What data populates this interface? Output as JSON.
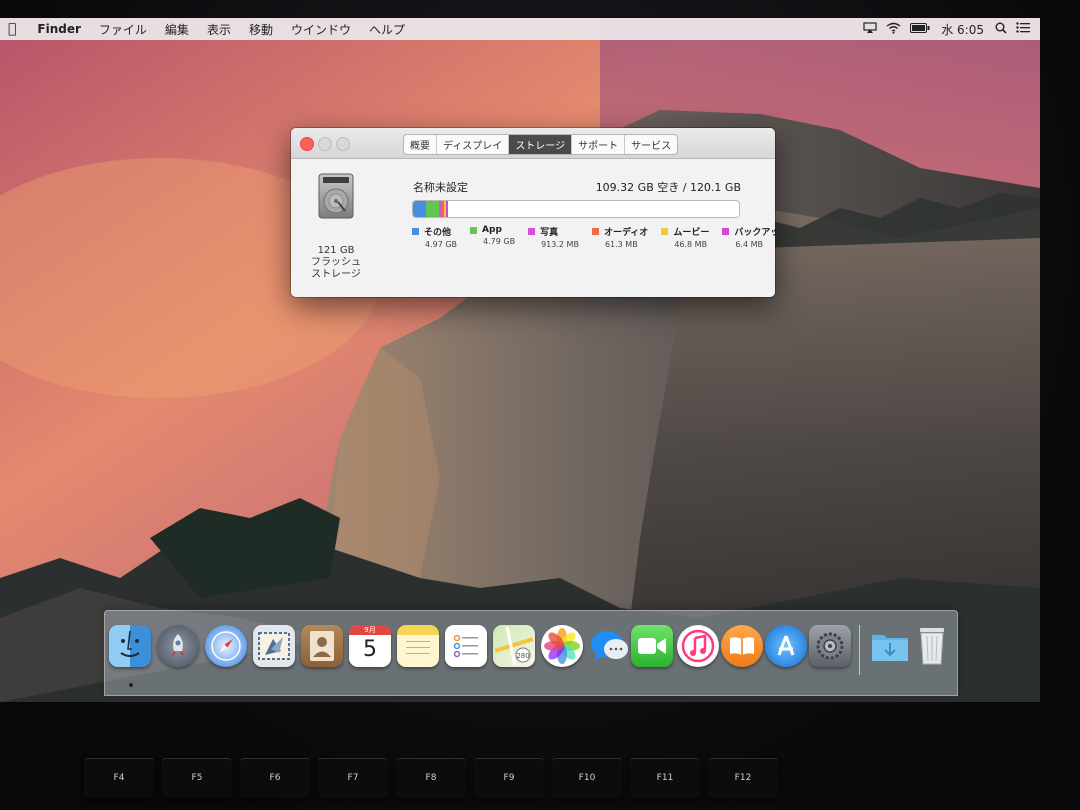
{
  "menubar": {
    "app_name": "Finder",
    "menus": [
      "ファイル",
      "編集",
      "表示",
      "移動",
      "ウインドウ",
      "ヘルプ"
    ],
    "clock": "水 6:05"
  },
  "window": {
    "tabs": [
      {
        "label": "概要",
        "active": false
      },
      {
        "label": "ディスプレイ",
        "active": false
      },
      {
        "label": "ストレージ",
        "active": true
      },
      {
        "label": "サポート",
        "active": false
      },
      {
        "label": "サービス",
        "active": false
      }
    ],
    "disk": {
      "capacity": "121 GB",
      "type_line1": "フラッシュ",
      "type_line2": "ストレージ"
    },
    "volume": {
      "name": "名称未設定",
      "free_text": "109.32 GB 空き / 120.1 GB"
    },
    "usage_bar": [
      {
        "fraction": 0.041,
        "color": "#4a8fdf"
      },
      {
        "fraction": 0.04,
        "color": "#63c552"
      },
      {
        "fraction": 0.0076,
        "color": "#d84fe0"
      },
      {
        "fraction": 0.0005,
        "color": "#ec6e44"
      },
      {
        "fraction": 0.0004,
        "color": "#f0c93a"
      },
      {
        "fraction": 0.0001,
        "color": "#cc4ecf"
      }
    ],
    "legend": [
      {
        "label": "その他",
        "size": "4.97 GB",
        "color": "#4a8fdf"
      },
      {
        "label": "App",
        "size": "4.79 GB",
        "color": "#63c552"
      },
      {
        "label": "写真",
        "size": "913.2 MB",
        "color": "#d84fe0"
      },
      {
        "label": "オーディオ",
        "size": "61.3 MB",
        "color": "#ec6e44"
      },
      {
        "label": "ムービー",
        "size": "46.8 MB",
        "color": "#f0c93a"
      },
      {
        "label": "バックアップ",
        "size": "6.4 MB",
        "color": "#cc4ecf"
      }
    ]
  },
  "dock": {
    "items": [
      {
        "name": "finder-icon"
      },
      {
        "name": "launchpad-icon"
      },
      {
        "name": "safari-icon"
      },
      {
        "name": "mail-icon"
      },
      {
        "name": "contacts-icon"
      },
      {
        "name": "calendar-icon",
        "month": "9月",
        "day": "5"
      },
      {
        "name": "notes-icon"
      },
      {
        "name": "reminders-icon"
      },
      {
        "name": "maps-icon"
      },
      {
        "name": "photos-icon"
      },
      {
        "name": "messages-icon"
      },
      {
        "name": "facetime-icon"
      },
      {
        "name": "itunes-icon"
      },
      {
        "name": "ibooks-icon"
      },
      {
        "name": "app-store-icon"
      },
      {
        "name": "system-preferences-icon"
      },
      {
        "name": "downloads-folder-icon"
      },
      {
        "name": "trash-icon"
      }
    ]
  },
  "keyboard": {
    "keys": [
      "F4",
      "F5",
      "F6",
      "F7",
      "F8",
      "F9",
      "F10",
      "F11",
      "F12"
    ]
  }
}
